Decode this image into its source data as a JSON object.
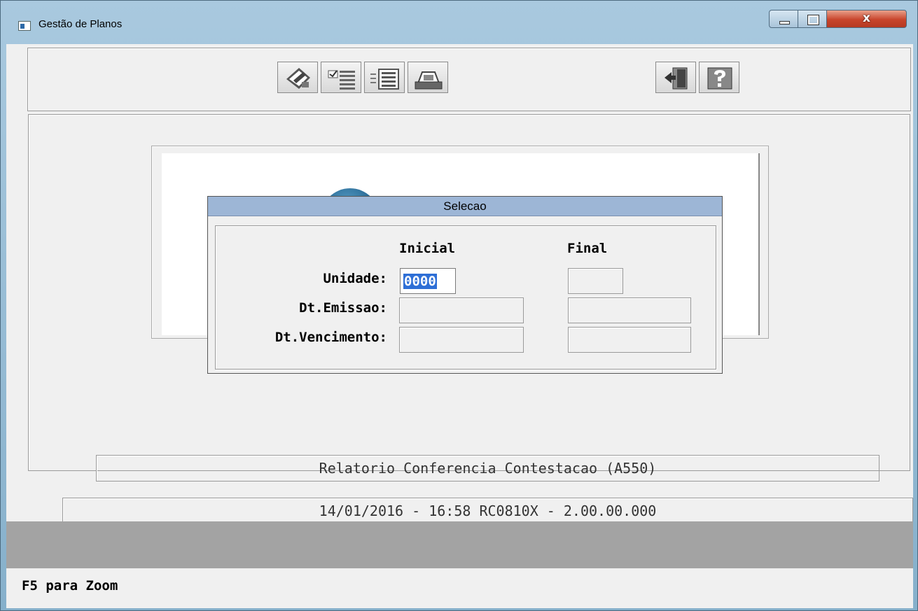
{
  "window": {
    "title": "Gestão de Planos",
    "close_glyph": "x"
  },
  "toolbar": {
    "left_buttons": [
      "pencil-icon",
      "checklist-icon",
      "list-icon",
      "printer-icon"
    ],
    "right_buttons": [
      "exit-door-icon",
      "help-icon"
    ]
  },
  "dialog": {
    "title": "Selecao",
    "col_inicial": "Inicial",
    "col_final": "Final",
    "rows": [
      {
        "label": "Unidade:",
        "inicial": "0000",
        "final": ""
      },
      {
        "label": "Dt.Emissao:",
        "inicial": "",
        "final": ""
      },
      {
        "label": "Dt.Vencimento:",
        "inicial": "",
        "final": ""
      }
    ]
  },
  "report_title": "Relatorio Conferencia Contestacao (A550)",
  "program_info": "14/01/2016 - 16:58  RC0810X - 2.00.00.000",
  "status_hint": "F5 para Zoom",
  "colors": {
    "dialog_title_bg": "#9db6d6",
    "selection": "#2e6fd6",
    "status_bar": "#a3a3a3"
  }
}
